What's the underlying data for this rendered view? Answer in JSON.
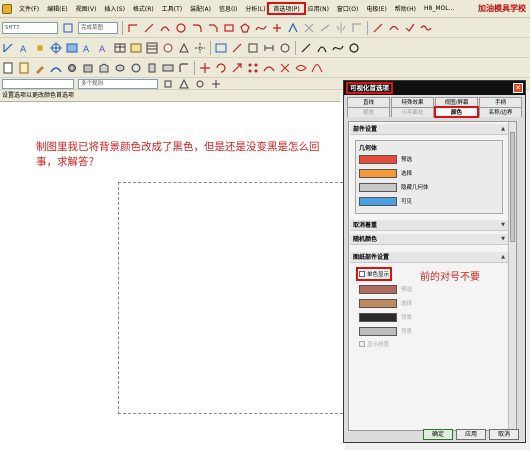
{
  "menubar": {
    "items": [
      "文件(F)",
      "编辑(E)",
      "视图(V)",
      "插入(S)",
      "格式(R)",
      "工具(T)",
      "装配(A)",
      "信息(I)",
      "分析(L)",
      "首选项(P)",
      "应用(N)",
      "窗口(O)",
      "电极(E)",
      "帮助(H)",
      "H8_MOL..."
    ],
    "brand": "加油模具学校"
  },
  "toolbar": {
    "combo_left": "SHT7",
    "combo_mid": "完成草图",
    "combo_filter": "多个规则"
  },
  "cue_line": "设置选项以更改颜色首选项",
  "canvas": {
    "note": "制图里我已将背景颜色改成了黑色，但是还是没变黑是怎么回事，求解答？",
    "annotation": "前的对号不要"
  },
  "dialog": {
    "title": "可视化首选项",
    "close": "✕",
    "tabs_row1": [
      "直线",
      "特殊效果",
      "视图/屏幕",
      "手柄"
    ],
    "tabs_row2": [
      "视觉",
      "小平面化",
      "颜色",
      "名称/边界"
    ],
    "active_tab": "颜色",
    "section_part": "部件设置",
    "geometry_box": "几何体",
    "geometry_colors": [
      {
        "label": "预选",
        "color": "#e84a3a"
      },
      {
        "label": "选择",
        "color": "#f29a3a"
      },
      {
        "label": "隐藏几何体",
        "color": "#c8c8c8"
      },
      {
        "label": "可见",
        "color": "#4aa0e0"
      }
    ],
    "section_cancel": "取消着重",
    "section_random": "随机颜色",
    "section_drawing": "图纸部件设置",
    "monochrome_label": "单色显示",
    "mono_colors": [
      {
        "label": "预选",
        "color": "#b06a60"
      },
      {
        "label": "选择",
        "color": "#c08a60"
      },
      {
        "label": "背景",
        "color": "#2a2a2a"
      },
      {
        "label": "背景",
        "color": "#bdbdbd"
      }
    ],
    "show_width_label": "显示线宽",
    "buttons": [
      "确定",
      "应用",
      "取消"
    ]
  }
}
